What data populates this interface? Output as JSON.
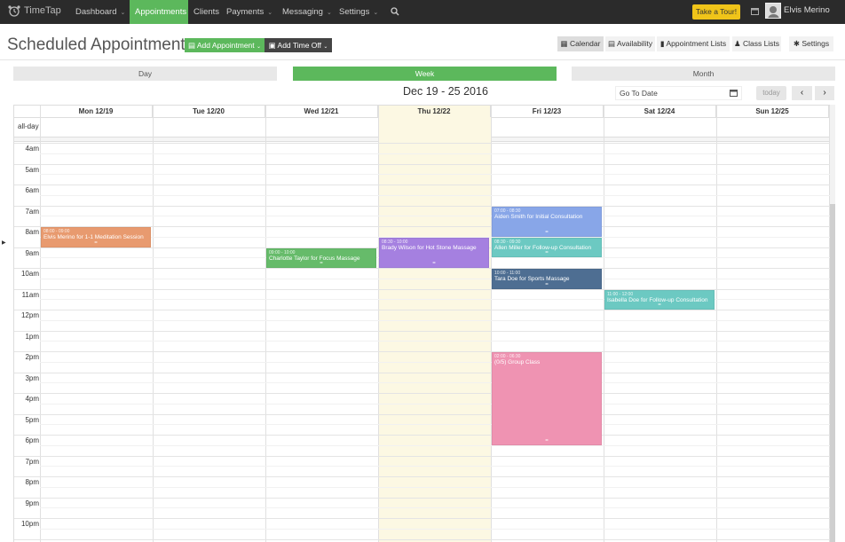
{
  "nav": {
    "logo": "TimeTap",
    "items": [
      {
        "label": "Dashboard",
        "chevron": true
      },
      {
        "label": "Appointments",
        "chevron": false,
        "active": true
      },
      {
        "label": "Clients",
        "chevron": false
      },
      {
        "label": "Payments",
        "chevron": true
      },
      {
        "label": "Messaging",
        "chevron": true
      },
      {
        "label": "Settings",
        "chevron": true
      }
    ],
    "tour_label": "Take a Tour!",
    "user_name": "Elvis Merino"
  },
  "header": {
    "title": "Scheduled Appointments",
    "add_appointment": "Add Appointment",
    "add_time_off": "Add Time Off",
    "views": [
      {
        "label": "Calendar",
        "active": true
      },
      {
        "label": "Availability"
      },
      {
        "label": "Appointment Lists"
      },
      {
        "label": "Class Lists"
      },
      {
        "label": "Settings"
      }
    ]
  },
  "modes": [
    {
      "label": "Day"
    },
    {
      "label": "Week",
      "active": true
    },
    {
      "label": "Month"
    }
  ],
  "toolbar": {
    "date_range": "Dec 19 - 25 2016",
    "goto_label": "Go To Date",
    "today_label": "today"
  },
  "calendar": {
    "allday_label": "all-day",
    "days": [
      "Mon 12/19",
      "Tue 12/20",
      "Wed 12/21",
      "Thu 12/22",
      "Fri 12/23",
      "Sat 12/24",
      "Sun 12/25"
    ],
    "today_index": 3,
    "hours": [
      "4am",
      "5am",
      "6am",
      "7am",
      "8am",
      "9am",
      "10am",
      "11am",
      "12pm",
      "1pm",
      "2pm",
      "3pm",
      "4pm",
      "5pm",
      "6pm",
      "7pm",
      "8pm",
      "9pm",
      "10pm"
    ],
    "events": [
      {
        "day": 0,
        "start": 8.0,
        "end": 9.0,
        "time": "08:00 - 09:00",
        "title": "Elvis Merino for 1-1 Meditation Session",
        "color": "#e89a6f"
      },
      {
        "day": 2,
        "start": 9.0,
        "end": 10.0,
        "time": "09:00 - 10:00",
        "title": "Charlotte Taylor for Focus Massage",
        "color": "#66bb6a"
      },
      {
        "day": 3,
        "start": 8.5,
        "end": 10.0,
        "time": "08:30 - 10:00",
        "title": "Brady Wilson for Hot Stone Massage",
        "color": "#a580e0"
      },
      {
        "day": 4,
        "start": 7.0,
        "end": 8.5,
        "time": "07:00 - 08:30",
        "title": "Aiden Smith for Initial Consultation",
        "color": "#88a6e8"
      },
      {
        "day": 4,
        "start": 8.5,
        "end": 9.5,
        "time": "08:30 - 09:30",
        "title": "Allen Miller for Follow-up Consultation",
        "color": "#6cc9c2"
      },
      {
        "day": 4,
        "start": 10.0,
        "end": 11.0,
        "time": "10:00 - 11:00",
        "title": "Tara Doe for Sports Massage",
        "color": "#4e6e92"
      },
      {
        "day": 5,
        "start": 11.0,
        "end": 12.0,
        "time": "11:00 - 12:00",
        "title": "Isabella Doe for Follow-up Consultation",
        "color": "#6cc9c2"
      },
      {
        "day": 4,
        "start": 14.0,
        "end": 18.5,
        "time": "02:00 - 06:30",
        "title": "(0/5) Group Class",
        "color": "#ef93b2"
      }
    ]
  }
}
